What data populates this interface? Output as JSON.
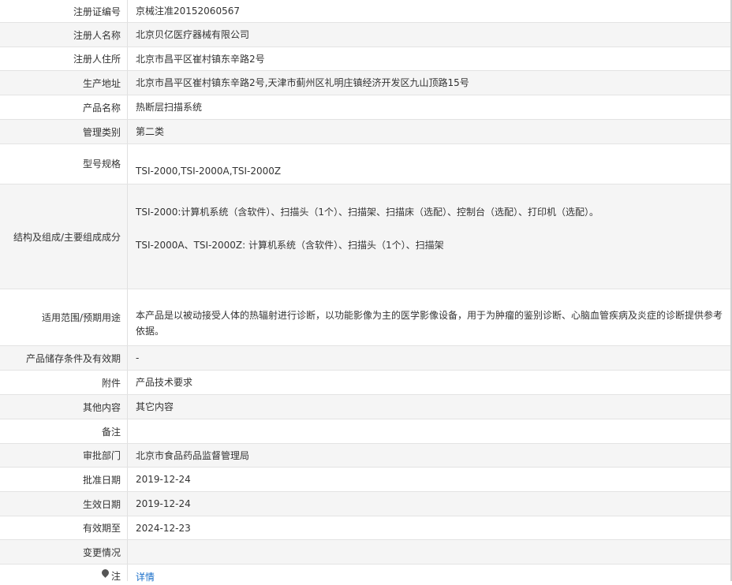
{
  "rows": [
    {
      "label": "注册证编号",
      "value": "京械注准20152060567"
    },
    {
      "label": "注册人名称",
      "value": "北京贝亿医疗器械有限公司"
    },
    {
      "label": "注册人住所",
      "value": "北京市昌平区崔村镇东辛路2号"
    },
    {
      "label": "生产地址",
      "value": "北京市昌平区崔村镇东辛路2号,天津市蓟州区礼明庄镇经济开发区九山顶路15号"
    },
    {
      "label": "产品名称",
      "value": "热断层扫描系统"
    },
    {
      "label": "管理类别",
      "value": "第二类"
    },
    {
      "label": "型号规格",
      "value": "TSI-2000,TSI-2000A,TSI-2000Z"
    },
    {
      "label": "结构及组成/主要组成成分",
      "value_line1": "TSI-2000:计算机系统（含软件）、扫描头（1个）、扫描架、扫描床（选配）、控制台（选配）、打印机（选配）。",
      "value_line2": "TSI-2000A、TSI-2000Z: 计算机系统（含软件）、扫描头（1个）、扫描架"
    },
    {
      "label": "适用范围/预期用途",
      "value": "本产品是以被动接受人体的热辐射进行诊断，以功能影像为主的医学影像设备，用于为肿瘤的鉴别诊断、心脑血管疾病及炎症的诊断提供参考依据。"
    },
    {
      "label": "产品储存条件及有效期",
      "value": "-"
    },
    {
      "label": "附件",
      "value": "产品技术要求"
    },
    {
      "label": "其他内容",
      "value": "其它内容"
    },
    {
      "label": "备注",
      "value": ""
    },
    {
      "label": "审批部门",
      "value": "北京市食品药品监督管理局"
    },
    {
      "label": "批准日期",
      "value": "2019-12-24"
    },
    {
      "label": "生效日期",
      "value": "2019-12-24"
    },
    {
      "label": "有效期至",
      "value": "2024-12-23"
    },
    {
      "label": "变更情况",
      "value": ""
    },
    {
      "label": "注",
      "value": "详情"
    }
  ]
}
